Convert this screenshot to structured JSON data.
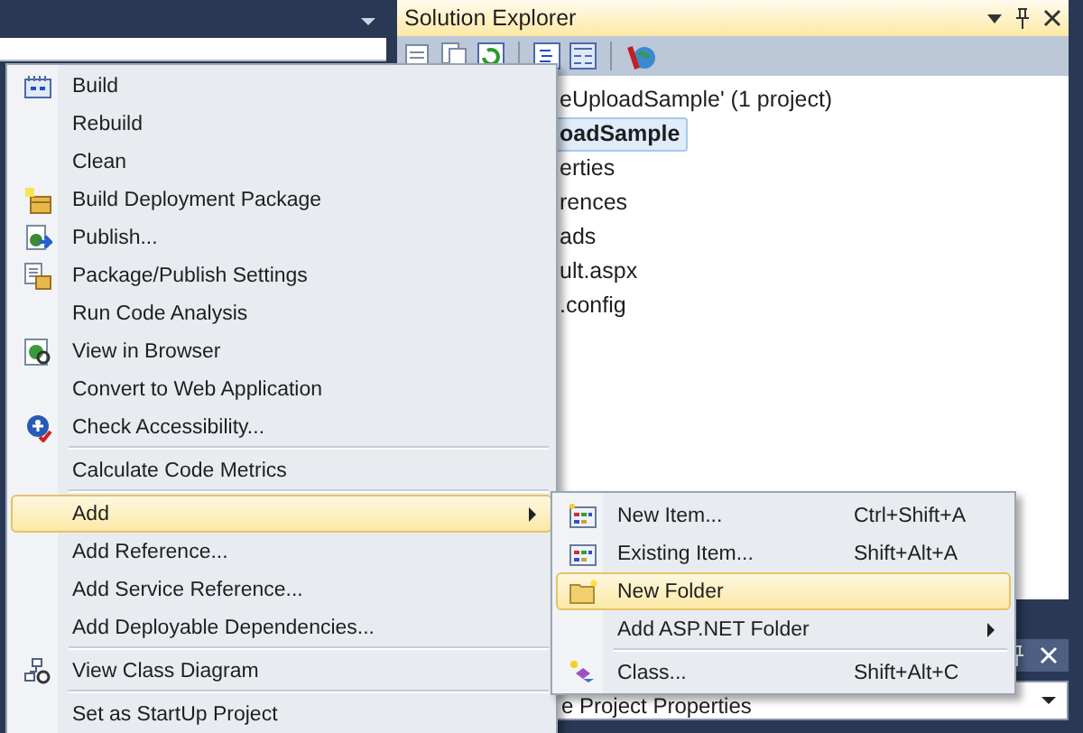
{
  "solution_explorer": {
    "title": "Solution Explorer",
    "tree": [
      {
        "label": "eUploadSample' (1 project)",
        "selected": false
      },
      {
        "label": "oadSample",
        "selected": true
      },
      {
        "label": "erties",
        "selected": false
      },
      {
        "label": "rences",
        "selected": false
      },
      {
        "label": "ads",
        "selected": false
      },
      {
        "label": "ult.aspx",
        "selected": false
      },
      {
        "label": ".config",
        "selected": false
      }
    ]
  },
  "properties_panel": {
    "value": "e Project Properties"
  },
  "context_menu": {
    "items": [
      {
        "kind": "command",
        "label": "Build",
        "selected": false
      },
      {
        "kind": "command",
        "label": "Rebuild",
        "selected": false
      },
      {
        "kind": "command",
        "label": "Clean",
        "selected": false
      },
      {
        "kind": "command",
        "label": "Build Deployment Package",
        "selected": false
      },
      {
        "kind": "command",
        "label": "Publish...",
        "selected": false
      },
      {
        "kind": "command",
        "label": "Package/Publish Settings",
        "selected": false
      },
      {
        "kind": "command",
        "label": "Run Code Analysis",
        "selected": false
      },
      {
        "kind": "command",
        "label": "View in Browser",
        "selected": false
      },
      {
        "kind": "command",
        "label": "Convert to Web Application",
        "selected": false
      },
      {
        "kind": "command",
        "label": "Check Accessibility...",
        "selected": false
      },
      {
        "kind": "separator"
      },
      {
        "kind": "command",
        "label": "Calculate Code Metrics",
        "selected": false
      },
      {
        "kind": "separator"
      },
      {
        "kind": "submenu",
        "label": "Add",
        "selected": true
      },
      {
        "kind": "command",
        "label": "Add Reference...",
        "selected": false
      },
      {
        "kind": "command",
        "label": "Add Service Reference...",
        "selected": false
      },
      {
        "kind": "command",
        "label": "Add Deployable Dependencies...",
        "selected": false
      },
      {
        "kind": "separator"
      },
      {
        "kind": "command",
        "label": "View Class Diagram",
        "selected": false
      },
      {
        "kind": "separator"
      },
      {
        "kind": "command",
        "label": "Set as StartUp Project",
        "selected": false
      }
    ]
  },
  "submenu": {
    "items": [
      {
        "kind": "command",
        "label": "New Item...",
        "shortcut": "Ctrl+Shift+A",
        "selected": false
      },
      {
        "kind": "command",
        "label": "Existing Item...",
        "shortcut": "Shift+Alt+A",
        "selected": false
      },
      {
        "kind": "command",
        "label": "New Folder",
        "selected": true
      },
      {
        "kind": "submenu",
        "label": "Add ASP.NET Folder",
        "selected": false
      },
      {
        "kind": "separator"
      },
      {
        "kind": "command",
        "label": "Class...",
        "shortcut": "Shift+Alt+C",
        "selected": false
      }
    ]
  }
}
